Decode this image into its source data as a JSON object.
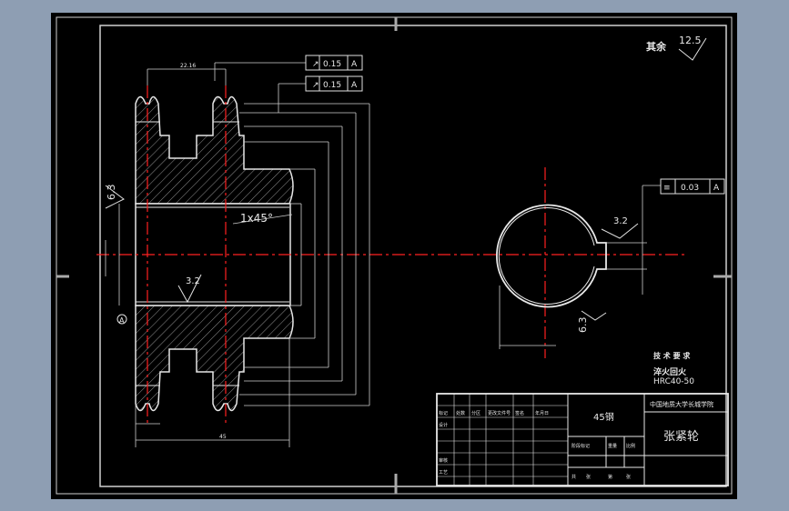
{
  "drawing": {
    "title": "张紧轮",
    "material": "45钢",
    "company": "中国地质大学长城学院",
    "surface_note_label": "其余",
    "surface_note_value": "12.5",
    "tech_req_title": "技 术 要 求",
    "tech_req_line1": "淬火回火",
    "tech_req_line2": "HRC40-50",
    "chamfer": "1x45°",
    "roughness_inner": "3.2",
    "roughness_left": "6.3",
    "roughness_key": "3.2",
    "roughness_bottom": "6.3",
    "tolerance_1_value": "0.15",
    "tolerance_1_datum": "A",
    "tolerance_2_value": "0.15",
    "tolerance_2_datum": "A",
    "tolerance_3_value": "0.03",
    "tolerance_3_datum": "A",
    "datum_label": "A",
    "dim_top": "22.16",
    "dim_bottom": "45",
    "title_block_rows": [
      "标记",
      "设计",
      "审核",
      "工艺"
    ],
    "title_block_cols": [
      "处数",
      "分区",
      "更改文件号",
      "签名",
      "年月日"
    ],
    "title_block_sub": [
      "阶段标记",
      "重量",
      "比例"
    ],
    "title_block_sheet": [
      "共",
      "张",
      "第",
      "张"
    ]
  }
}
